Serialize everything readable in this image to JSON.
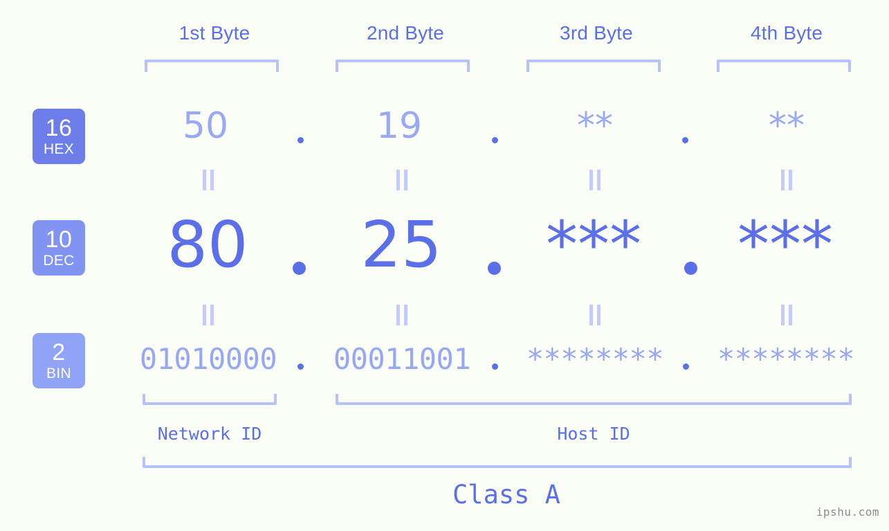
{
  "meta": {
    "background": "#fbfdf7",
    "accent_strong": "#5a6fe8",
    "accent_mid": "#98a7f4",
    "accent_light": "#b7c1fb",
    "watermark": "ipshu.com"
  },
  "columns": [
    {
      "label": "1st Byte",
      "hex": "50",
      "dec": "80",
      "bin": "01010000"
    },
    {
      "label": "2nd Byte",
      "hex": "19",
      "dec": "25",
      "bin": "00011001"
    },
    {
      "label": "3rd Byte",
      "hex": "**",
      "dec": "***",
      "bin": "********"
    },
    {
      "label": "4th Byte",
      "hex": "**",
      "dec": "***",
      "bin": "********"
    }
  ],
  "bases": [
    {
      "num": "16",
      "abbr": "HEX",
      "color": "#6d7eea"
    },
    {
      "num": "10",
      "abbr": "DEC",
      "color": "#8194f2"
    },
    {
      "num": "2",
      "abbr": "BIN",
      "color": "#90a3f7"
    }
  ],
  "separators": {
    "dot": ".",
    "equals": "="
  },
  "groups": {
    "network_id": "Network ID",
    "host_id": "Host ID",
    "class": "Class A"
  }
}
